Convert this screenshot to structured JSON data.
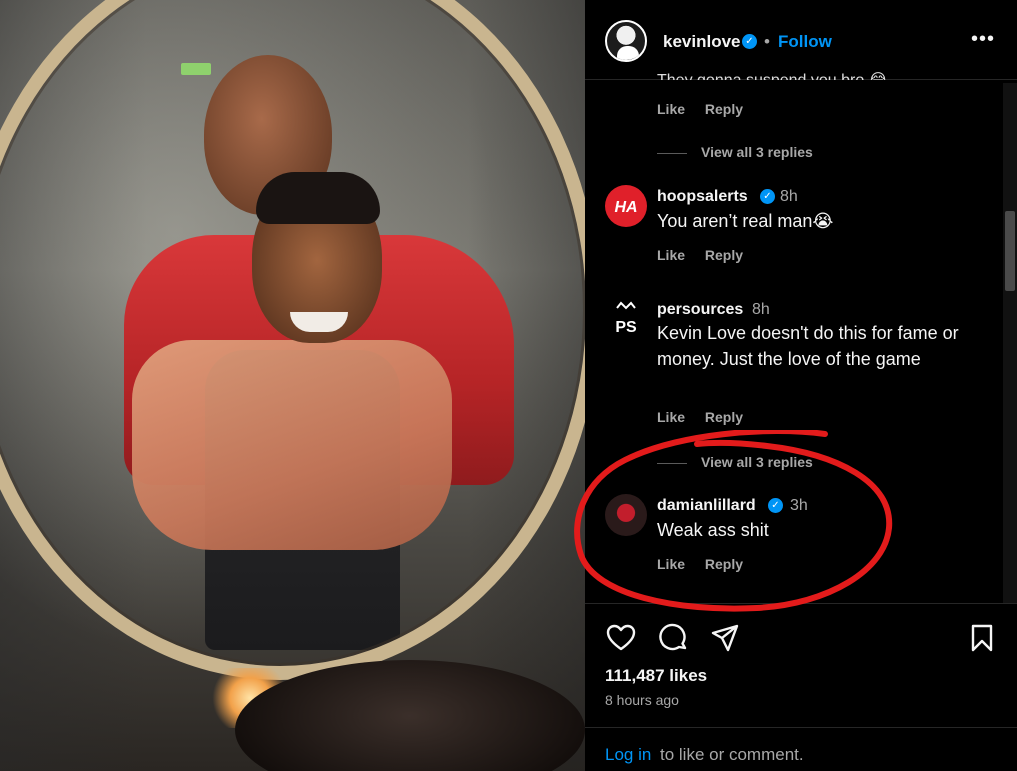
{
  "post": {
    "username": "kevinlove",
    "verified": true,
    "follow_label": "Follow",
    "separator": "•",
    "more_label": "•••"
  },
  "truncated_comment": "They gonna suspend you bro 😂",
  "first_comment_actions": {
    "like": "Like",
    "reply": "Reply"
  },
  "first_view_replies": "View all 3 replies",
  "comments": [
    {
      "username": "hoopsalerts",
      "verified": true,
      "time": "8h",
      "text": "You aren’t real man😭",
      "like": "Like",
      "reply": "Reply",
      "avatar_color": "#e0202a",
      "avatar_mark": "HA"
    },
    {
      "username": "persources",
      "verified": false,
      "time": "8h",
      "text": "Kevin Love doesn't do this for fame or money. Just the love of the game",
      "like": "Like",
      "reply": "Reply",
      "view_replies": "View all 3 replies",
      "avatar_mark": "PS"
    },
    {
      "username": "damianlillard",
      "verified": true,
      "time": "3h",
      "text": "Weak ass shit",
      "like": "Like",
      "reply": "Reply",
      "avatar_color": "#2a1a1a"
    }
  ],
  "footer": {
    "likes": "111,487 likes",
    "time_ago": "8 hours ago",
    "login_link": "Log in",
    "login_rest": "to like or comment."
  },
  "colors": {
    "accent": "#0095f6",
    "annotation": "#e31b1b",
    "muted": "#a8a8a8"
  }
}
